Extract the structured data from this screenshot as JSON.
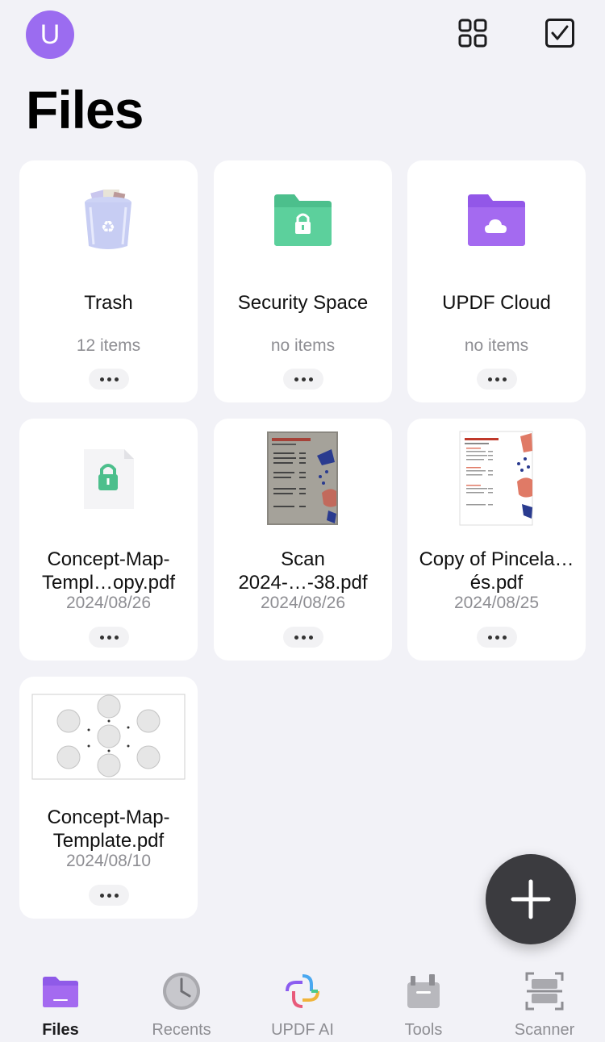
{
  "header": {
    "avatar_letter": "U",
    "title": "Files"
  },
  "folders": [
    {
      "name": "Trash",
      "meta": "12 items",
      "icon": "trash-icon"
    },
    {
      "name": "Security Space",
      "meta": "no items",
      "icon": "lock-folder-icon"
    },
    {
      "name": "UPDF Cloud",
      "meta": "no items",
      "icon": "cloud-folder-icon"
    }
  ],
  "files": [
    {
      "name": "Concept-Map-Templ…opy.pdf",
      "date": "2024/08/26"
    },
    {
      "name": "Scan 2024-…-38.pdf",
      "date": "2024/08/26"
    },
    {
      "name": "Copy of Pincela…és.pdf",
      "date": "2024/08/25"
    },
    {
      "name": "Concept-Map-Template.pdf",
      "date": "2024/08/10"
    }
  ],
  "tabs": [
    {
      "label": "Files",
      "icon": "folder-icon",
      "active": true
    },
    {
      "label": "Recents",
      "icon": "clock-icon"
    },
    {
      "label": "UPDF AI",
      "icon": "ai-icon"
    },
    {
      "label": "Tools",
      "icon": "toolbox-icon"
    },
    {
      "label": "Scanner",
      "icon": "scanner-icon"
    }
  ],
  "colors": {
    "accent": "#9b6cf0",
    "security_green": "#4cbf8c",
    "cloud_purple": "#a46af0",
    "background": "#f2f2f7"
  }
}
